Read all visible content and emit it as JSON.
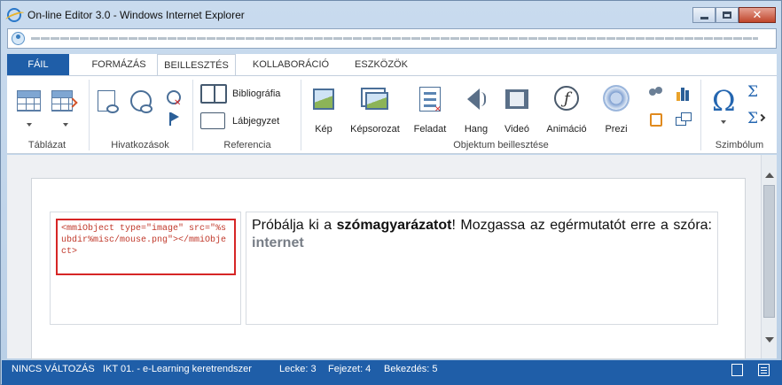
{
  "window": {
    "title": "On-line Editor 3.0 - Windows Internet Explorer",
    "address_url": "▬▬▬▬▬▬▬▬▬▬▬▬▬▬▬▬▬▬▬▬▬▬▬▬▬▬▬▬▬▬▬▬▬▬▬▬▬▬▬▬▬▬▬▬▬▬▬▬▬▬▬▬▬▬▬▬▬▬▬▬▬▬▬▬▬▬▬▬▬▬▬▬▬▬▬▬▬▬▬▬▬▬▬▬▬▬▬▬▬▬▬▬▬"
  },
  "ribbon": {
    "tabs": [
      {
        "label": "FÁIL"
      },
      {
        "label": "FORMÁZÁS"
      },
      {
        "label": "BEILLESZTÉS"
      },
      {
        "label": "KOLLABORÁCIÓ"
      },
      {
        "label": "ESZKÖZÖK"
      }
    ],
    "groups": {
      "table": "Táblázat",
      "links": "Hivatkozások",
      "reference": "Referencia",
      "objects": "Objektum beillesztése",
      "symbols": "Szimbólum"
    },
    "buttons": {
      "bibliography": "Bibliográfia",
      "footnote": "Lábjegyzet",
      "image": "Kép",
      "gallery": "Képsorozat",
      "task": "Feladat",
      "sound": "Hang",
      "video": "Videó",
      "animation": "Animáció",
      "prezi": "Prezi",
      "omega": "Ω",
      "sigma": "Σ",
      "sigma_arrow": "Σ"
    }
  },
  "editor": {
    "code": "<mmiObject type=\"image\" src=\"%subdir%misc/mouse.png\"></mmiObject>",
    "text_before": "Próbálja ki a ",
    "text_bold": "szómagyarázatot",
    "text_after": "! Mozgassa az egérmutatót erre a szóra: ",
    "term": "internet"
  },
  "status": {
    "state": "NINCS VÁLTOZÁS",
    "course": "IKT 01. - e-Learning keretrendszer",
    "lesson": "Lecke: 3",
    "chapter": "Fejezet: 4",
    "paragraph": "Bekezdés: 5"
  },
  "colors": {
    "accent": "#1f5ea8",
    "code_border": "#d62626"
  }
}
